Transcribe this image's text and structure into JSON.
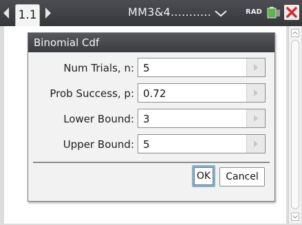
{
  "tabs": [
    {
      "label": "1.1"
    }
  ],
  "document": {
    "title": "MM3&4..........."
  },
  "status": {
    "mode": "RAD"
  },
  "dialog": {
    "title": "Binomial Cdf",
    "fields": [
      {
        "label": "Num Trials, n:",
        "value": "5"
      },
      {
        "label": "Prob Success, p:",
        "value": "0.72"
      },
      {
        "label": "Lower Bound:",
        "value": "3"
      },
      {
        "label": "Upper Bound:",
        "value": "5"
      }
    ],
    "buttons": {
      "ok": "OK",
      "cancel": "Cancel"
    }
  },
  "colors": {
    "title_bar": "#3f4145",
    "close": "#d62b2b",
    "battery": "#5fb34a",
    "focus_ring": "#7fb3d3"
  },
  "icons": [
    "tab-left-arrow-icon",
    "tab-right-arrow-icon",
    "chevron-down-icon",
    "battery-icon",
    "close-icon",
    "scroll-up-icon",
    "scroll-down-icon"
  ]
}
